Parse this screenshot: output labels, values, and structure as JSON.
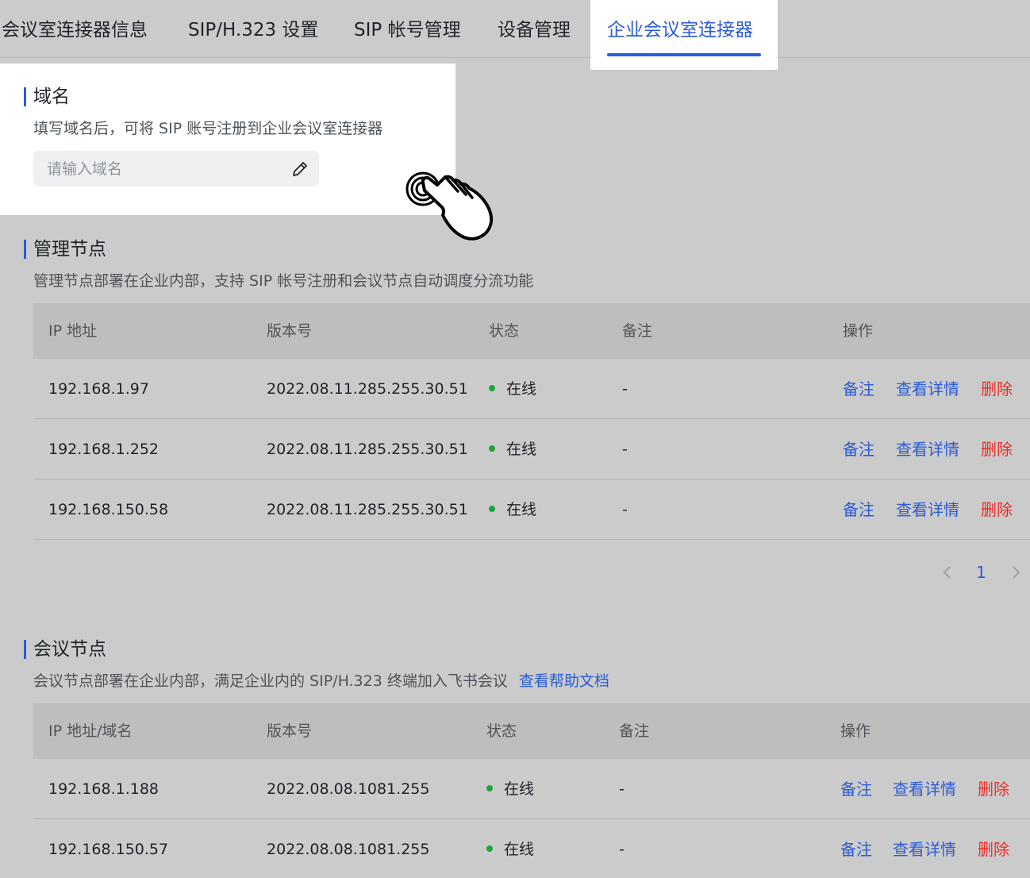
{
  "tabs": [
    {
      "label": "会议室连接器信息"
    },
    {
      "label": "SIP/H.323 设置"
    },
    {
      "label": "SIP 帐号管理"
    },
    {
      "label": "设备管理"
    },
    {
      "label": "企业会议室连接器",
      "active": true
    }
  ],
  "domain": {
    "title": "域名",
    "description": "填写域名后，可将 SIP 账号注册到企业会议室连接器",
    "input_value": "",
    "input_placeholder": "请输入域名"
  },
  "management_nodes": {
    "title": "管理节点",
    "description": "管理节点部署在企业内部，支持 SIP 帐号注册和会议节点自动调度分流功能",
    "columns": [
      "IP 地址",
      "版本号",
      "状态",
      "备注",
      "操作"
    ],
    "rows": [
      {
        "ip": "192.168.1.97",
        "version": "2022.08.11.285.255.30.51",
        "status": "在线",
        "note": "-"
      },
      {
        "ip": "192.168.1.252",
        "version": "2022.08.11.285.255.30.51",
        "status": "在线",
        "note": "-"
      },
      {
        "ip": "192.168.150.58",
        "version": "2022.08.11.285.255.30.51",
        "status": "在线",
        "note": "-"
      }
    ],
    "actions": {
      "note": "备注",
      "detail": "查看详情",
      "delete": "删除"
    },
    "pagination": {
      "current": "1"
    }
  },
  "meeting_nodes": {
    "title": "会议节点",
    "description": "会议节点部署在企业内部，满足企业内的 SIP/H.323 终端加入飞书会议",
    "help_link": "查看帮助文档",
    "columns": [
      "IP 地址/域名",
      "版本号",
      "状态",
      "备注",
      "操作"
    ],
    "rows": [
      {
        "ip": "192.168.1.188",
        "version": "2022.08.08.1081.255",
        "status": "在线",
        "note": "-"
      },
      {
        "ip": "192.168.150.57",
        "version": "2022.08.08.1081.255",
        "status": "在线",
        "note": "-"
      }
    ],
    "actions": {
      "note": "备注",
      "detail": "查看详情",
      "delete": "删除"
    }
  },
  "colors": {
    "accent": "#2a5bd7",
    "danger": "#e4312b",
    "online": "#1ca63a"
  },
  "icons": {
    "edit": "pencil-icon",
    "prev": "chevron-left-icon",
    "next": "chevron-right-icon",
    "pointer": "pointing-hand-icon"
  }
}
